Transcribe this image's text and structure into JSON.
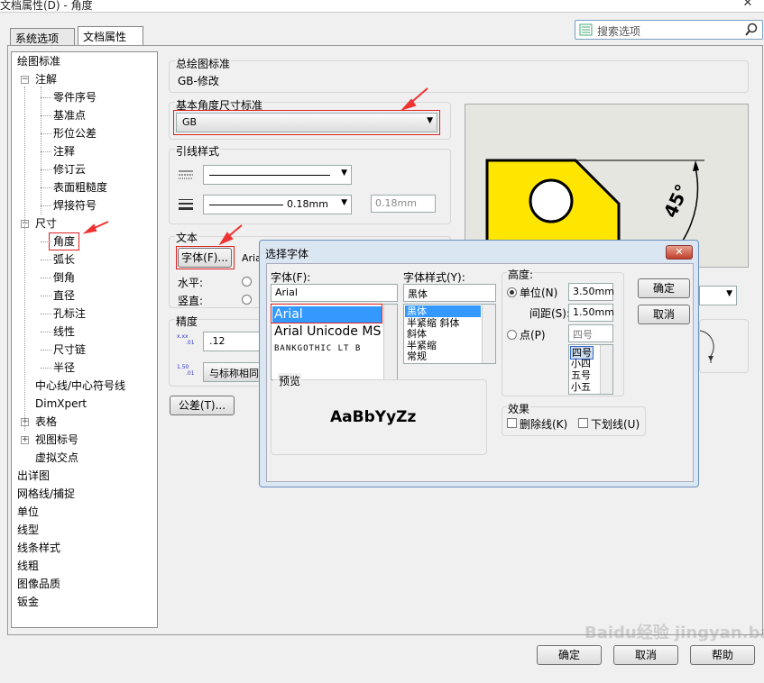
{
  "window": {
    "title": "文档属性(D) - 角度",
    "close": "✕"
  },
  "tabs": [
    "系统选项(S)",
    "文档属性(D)"
  ],
  "search": {
    "placeholder": "搜索选项"
  },
  "tree": [
    {
      "label": "绘图标准",
      "indent": 0
    },
    {
      "label": "注解",
      "indent": 1,
      "exp": "-"
    },
    {
      "label": "零件序号",
      "indent": 2
    },
    {
      "label": "基准点",
      "indent": 2
    },
    {
      "label": "形位公差",
      "indent": 2
    },
    {
      "label": "注释",
      "indent": 2
    },
    {
      "label": "修订云",
      "indent": 2
    },
    {
      "label": "表面粗糙度",
      "indent": 2
    },
    {
      "label": "焊接符号",
      "indent": 2
    },
    {
      "label": "尺寸",
      "indent": 1,
      "exp": "-"
    },
    {
      "label": "角度",
      "indent": 2,
      "selected": true
    },
    {
      "label": "弧长",
      "indent": 2
    },
    {
      "label": "倒角",
      "indent": 2
    },
    {
      "label": "直径",
      "indent": 2
    },
    {
      "label": "孔标注",
      "indent": 2
    },
    {
      "label": "线性",
      "indent": 2
    },
    {
      "label": "尺寸链",
      "indent": 2
    },
    {
      "label": "半径",
      "indent": 2
    },
    {
      "label": "中心线/中心符号线",
      "indent": 1
    },
    {
      "label": "DimXpert",
      "indent": 1
    },
    {
      "label": "表格",
      "indent": 1,
      "exp": "+"
    },
    {
      "label": "视图标号",
      "indent": 1,
      "exp": "+"
    },
    {
      "label": "虚拟交点",
      "indent": 1
    },
    {
      "label": "出详图",
      "indent": 0
    },
    {
      "label": "网格线/捕捉",
      "indent": 0
    },
    {
      "label": "单位",
      "indent": 0
    },
    {
      "label": "线型",
      "indent": 0
    },
    {
      "label": "线条样式",
      "indent": 0
    },
    {
      "label": "线粗",
      "indent": 0
    },
    {
      "label": "图像品质",
      "indent": 0
    },
    {
      "label": "钣金",
      "indent": 0
    }
  ],
  "overall": {
    "label": "总绘图标准",
    "value": "GB-修改"
  },
  "base": {
    "label": "基本角度尺寸标准",
    "value": "GB"
  },
  "leader": {
    "label": "引线样式",
    "thickness": "0.18mm",
    "thickness_field": "0.18mm"
  },
  "text": {
    "label": "文本",
    "font_button": "字体(F)...",
    "font_name": "Aria",
    "horizontal": "水平:",
    "vertical": "竖直:"
  },
  "precision": {
    "label": "精度",
    "value": ".12",
    "same_as": "与标称相同"
  },
  "tolerance_button": "公差(T)...",
  "preview_angle": "45°",
  "font_dialog": {
    "title": "选择字体",
    "font_label": "字体(F):",
    "font_value": "Arial",
    "fonts": [
      "Arial",
      "Arial Unicode MS",
      "BANKGOTHIC LT B"
    ],
    "style_label": "字体样式(Y):",
    "style_value": "黑体",
    "styles": [
      "黑体",
      "半紧缩 斜体",
      "斜体",
      "半紧缩",
      "常规"
    ],
    "height_label": "高度:",
    "unit_label": "单位(N)",
    "unit_value": "3.50mm",
    "spacing_label": "间距(S):",
    "spacing_value": "1.50mm",
    "point_label": "点(P)",
    "point_value": "四号",
    "sizes": [
      "四号",
      "小四",
      "五号",
      "小五"
    ],
    "ok": "确定",
    "cancel": "取消",
    "preview_label": "预览",
    "preview_text": "AaBbYyZz",
    "effects_label": "效果",
    "strike": "删除线(K)",
    "underline": "下划线(U)"
  },
  "footer": {
    "ok": "确定",
    "cancel": "取消",
    "help": "帮助"
  },
  "watermark": "Baidu经验 jingyan.baidu.com"
}
